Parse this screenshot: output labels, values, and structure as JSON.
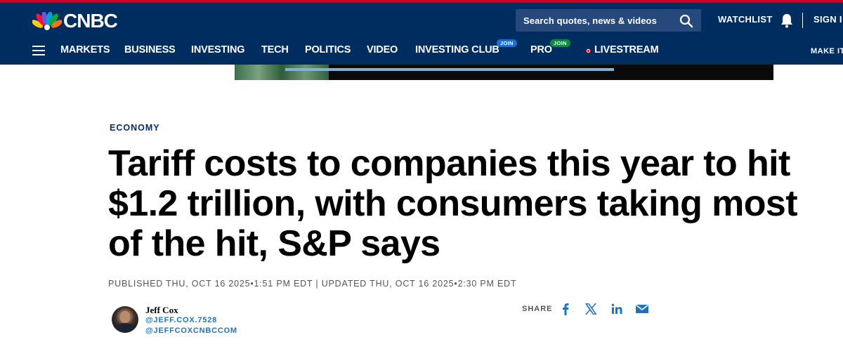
{
  "header": {
    "brand": "CNBC",
    "search_placeholder": "Search quotes, news & videos",
    "watchlist_label": "WATCHLIST",
    "signin_label": "SIGN I",
    "make_it_label": "MAKE IT"
  },
  "nav": {
    "items": [
      {
        "label": "MARKETS"
      },
      {
        "label": "BUSINESS"
      },
      {
        "label": "INVESTING"
      },
      {
        "label": "TECH"
      },
      {
        "label": "POLITICS"
      },
      {
        "label": "VIDEO"
      },
      {
        "label": "INVESTING CLUB",
        "badge": "JOIN"
      },
      {
        "label": "PRO",
        "badge": "JOIN"
      },
      {
        "label": "LIVESTREAM"
      }
    ]
  },
  "article": {
    "eyebrow": "ECONOMY",
    "headline": "Tariff costs to companies this year to hit $1.2 trillion, with consumers taking most of the hit, S&P says",
    "dates": "PUBLISHED THU, OCT 16 2025•1:51 PM EDT | UPDATED THU, OCT 16 2025•2:30 PM EDT",
    "author": {
      "name": "Jeff Cox",
      "handle_1": "@JEFF.COX.7528",
      "handle_2": "@JEFFCOXCNBCCOM"
    },
    "share_label": "SHARE"
  },
  "icons": {
    "search": "search-icon",
    "bell": "bell-icon",
    "menu": "hamburger-icon",
    "facebook": "facebook-icon",
    "x": "x-icon",
    "linkedin": "linkedin-icon",
    "email": "email-icon",
    "logo": "peacock-icon"
  },
  "colors": {
    "header_bg": "#002d5f",
    "accent_red": "#d0021b",
    "eyebrow": "#012f6b",
    "link_blue": "#1f74b8",
    "join_badge_blue": "#1f6fd1",
    "join_badge_green": "#118845"
  }
}
